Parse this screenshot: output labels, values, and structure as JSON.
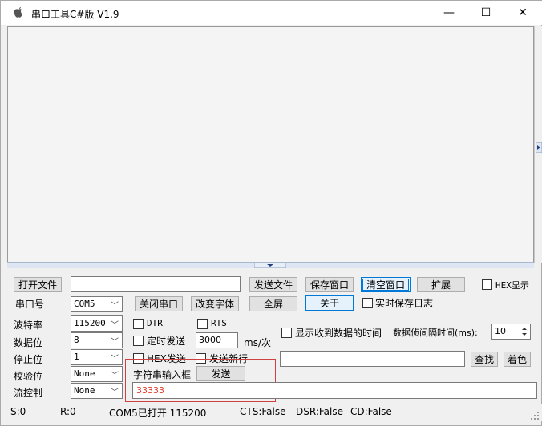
{
  "window": {
    "title": "串口工具C#版  V1.9",
    "minimize_glyph": "—",
    "maximize_glyph": "☐",
    "close_glyph": "✕"
  },
  "toolbar": {
    "open_file": "打开文件",
    "file_path": "",
    "send_file": "发送文件",
    "save_window": "保存窗口",
    "clear_window": "清空窗口",
    "expand": "扩展",
    "hex_display": "HEX显示",
    "serial_port_label": "串口号",
    "serial_port_value": "COM5",
    "close_port": "关闭串口",
    "change_font": "改变字体",
    "fullscreen": "全屏",
    "about": "关于",
    "realtime_log": "实时保存日志"
  },
  "settings": {
    "baud_label": "波特率",
    "baud_value": "115200",
    "databits_label": "数据位",
    "databits_value": "8",
    "stopbits_label": "停止位",
    "stopbits_value": "1",
    "parity_label": "校验位",
    "parity_value": "None",
    "flow_label": "流控制",
    "flow_value": "None"
  },
  "send_options": {
    "dtr": "DTR",
    "rts": "RTS",
    "timed_send": "定时发送",
    "interval_value": "3000",
    "interval_unit": "ms/次",
    "hex_send": "HEX发送",
    "send_newline": "发送新行",
    "string_input_label": "字符串输入框",
    "send_button": "发送",
    "send_text": "33333"
  },
  "receive_options": {
    "show_time": "显示收到数据的时间",
    "frame_interval_label": "数据侦间隔时间(ms):",
    "frame_interval_value": "10",
    "search_value": "",
    "find": "查找",
    "color": "着色"
  },
  "status": {
    "sent": "S:0",
    "received": "R:0",
    "port_state": "COM5已打开  115200",
    "cts": "CTS:False",
    "dsr": "DSR:False",
    "cd": "CD:False"
  },
  "colors": {
    "accent": "#0078d7",
    "highlight_box": "#d04040",
    "send_text": "#e03c28"
  }
}
